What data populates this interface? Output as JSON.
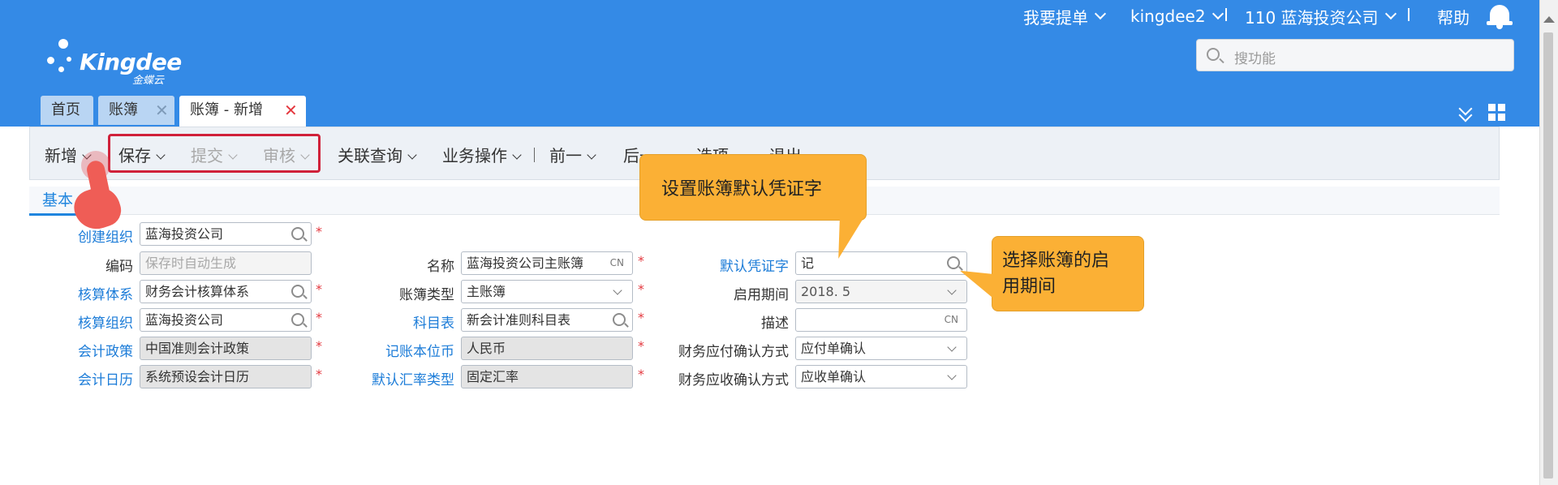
{
  "header": {
    "logo_text": "Kingdee",
    "logo_sub": "金蝶云",
    "nav": {
      "submit_ticket": "我要提单",
      "user": "kingdee2",
      "org": "110 蓝海投资公司",
      "help": "帮助"
    },
    "search_placeholder": "搜功能",
    "tabs": [
      {
        "label": "首页"
      },
      {
        "label": "账簿"
      },
      {
        "label": "账簿 - 新增"
      }
    ]
  },
  "toolbar": {
    "new": "新增",
    "save": "保存",
    "submit": "提交",
    "audit": "审核",
    "related_query": "关联查询",
    "business_ops": "业务操作",
    "prev": "前一",
    "next": "后一",
    "options": "选项",
    "exit": "退出"
  },
  "subtab": "基本",
  "form": {
    "col1": [
      {
        "label": "创建组织",
        "value": "蓝海投资公司"
      },
      {
        "label": "编码",
        "placeholder": "保存时自动生成"
      },
      {
        "label": "核算体系",
        "value": "财务会计核算体系"
      },
      {
        "label": "核算组织",
        "value": "蓝海投资公司"
      },
      {
        "label": "会计政策",
        "value": "中国准则会计政策"
      },
      {
        "label": "会计日历",
        "value": "系统预设会计日历"
      }
    ],
    "col2": [
      {
        "label": "名称",
        "value": "蓝海投资公司主账簿",
        "lang": "CN"
      },
      {
        "label": "账簿类型",
        "value": "主账簿"
      },
      {
        "label": "科目表",
        "value": "新会计准则科目表"
      },
      {
        "label": "记账本位币",
        "value": "人民币"
      },
      {
        "label": "默认汇率类型",
        "value": "固定汇率"
      }
    ],
    "col3": [
      {
        "label": "默认凭证字",
        "value": "记"
      },
      {
        "label": "启用期间",
        "value": "2018. 5"
      },
      {
        "label": "描述",
        "value": "",
        "lang": "CN"
      },
      {
        "label": "财务应付确认方式",
        "value": "应付单确认"
      },
      {
        "label": "财务应收确认方式",
        "value": "应收单确认"
      }
    ],
    "required_mark": "*"
  },
  "callouts": {
    "voucher": "设置账簿默认凭证字",
    "period_line1": "选择账簿的启",
    "period_line2": "用期间"
  },
  "colors": {
    "header_blue": "#348ae6",
    "link_blue": "#1c7cd8",
    "callout_orange": "#fbb035",
    "highlight_red": "#d0213a"
  },
  "icons": [
    "bell-icon",
    "search-icon",
    "close-icon",
    "double-chevron-down-icon",
    "grid-icon",
    "pointer-hand-icon"
  ]
}
